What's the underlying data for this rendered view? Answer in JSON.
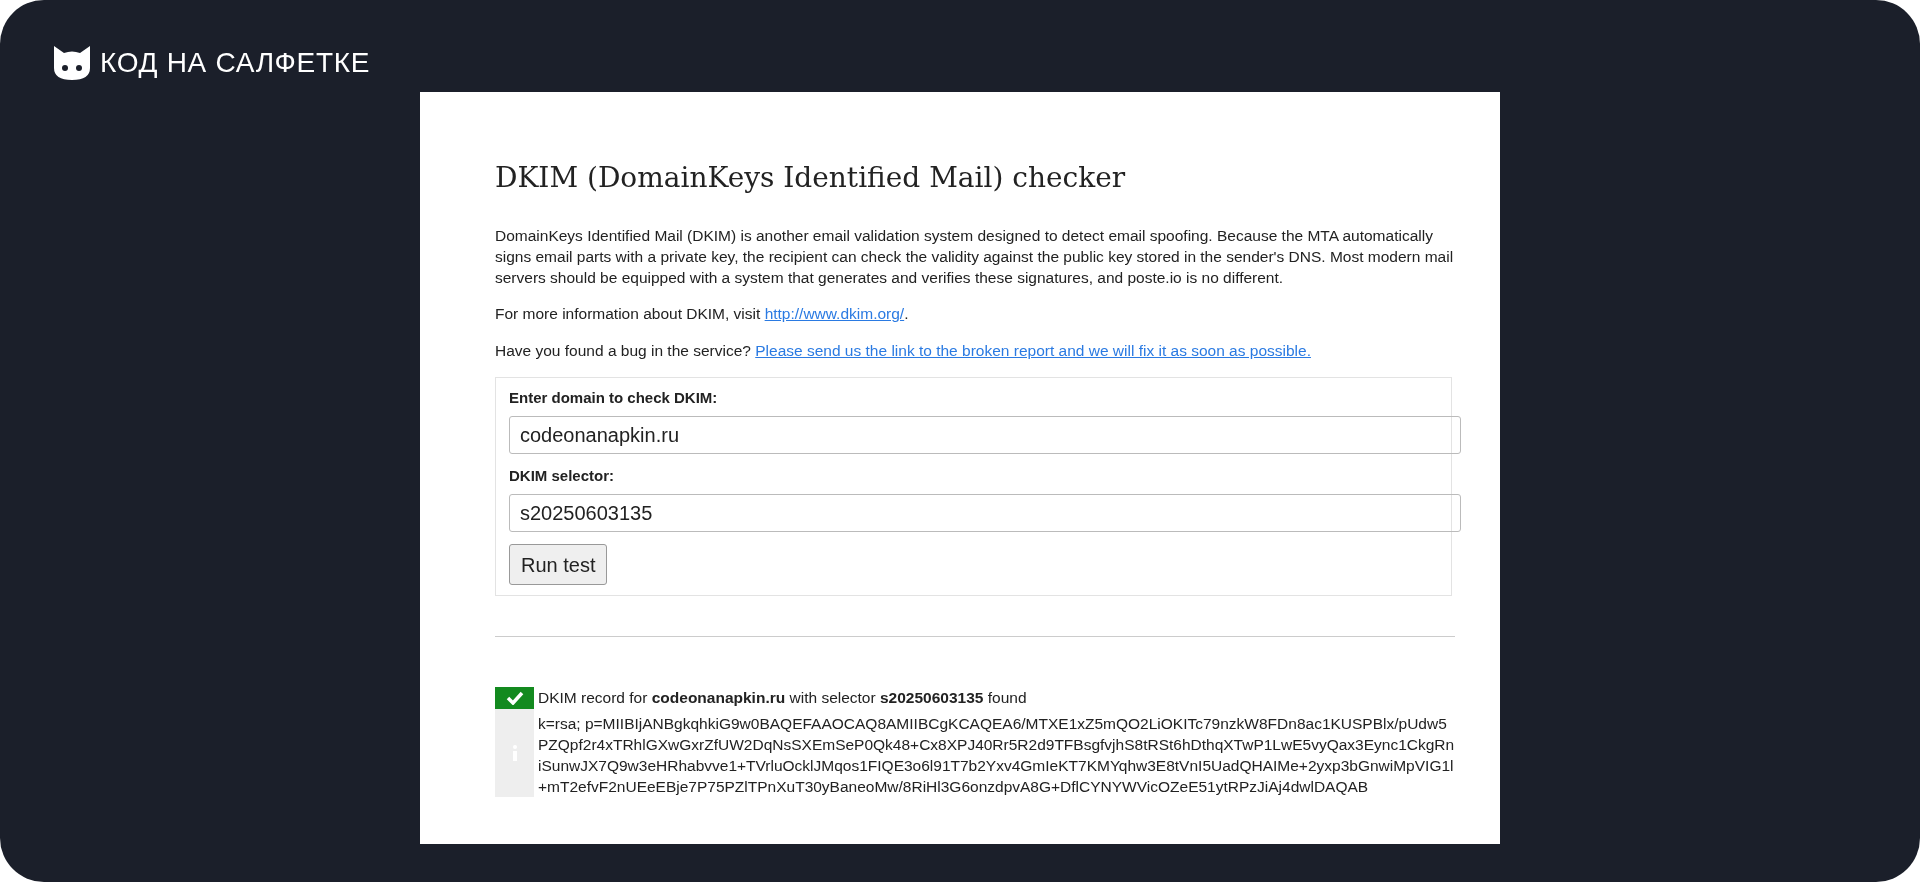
{
  "brand": {
    "name": "КОД НА САЛФЕТКЕ"
  },
  "page": {
    "title": "DKIM (DomainKeys Identified Mail) checker",
    "intro": "DomainKeys Identified Mail (DKIM) is another email validation system designed to detect email spoofing. Because the MTA automatically signs email parts with a private key, the recipient can check the validity against the public key stored in the sender's DNS. Most modern mail servers should be equipped with a system that generates and verifies these signatures, and poste.io is no different.",
    "info": {
      "text": "For more information about DKIM, visit ",
      "link": "http://www.dkim.org/",
      "after": "."
    },
    "bug": {
      "text": "Have you found a bug in the service? ",
      "link": "Please send us the link to the broken report and we will fix it as soon as possible."
    }
  },
  "form": {
    "fields": [
      {
        "label": "Enter domain to check DKIM:",
        "value": "codeonanapkin.ru"
      },
      {
        "label": "DKIM selector:",
        "value": "s20250603135"
      }
    ],
    "button": "Run test"
  },
  "result": {
    "found": true,
    "summary": "DKIM record for **codeonanapkin.ru** with selector **s20250603135** found",
    "record": "k=rsa; p=MIIBIjANBgkqhkiG9w0BAQEFAAOCAQ8AMIIBCgKCAQEA6/MTXE1xZ5mQO2LiOKITc79nzkW8FDn8ac1KUSPBlx/pUdw5PZQpf2r4xTRhlGXwGxrZfUW2DqNsSXEmSeP0Qk48+Cx8XPJ40Rr5R2d9TFBsgfvjhS8tRSt6hDthqXTwP1LwE5vyQax3Eync1CkgRniSunwJX7Q9w3eHRhabvve1+TVrluOcklJMqos1FIQE3o6l91T7b2Yxv4GmIeKT7KMYqhw3E8tVnI5UadQHAIMe+2yxp3bGnwiMpVIG1l+mT2efvF2nUEeEBje7P75PZlTPnXuT30yBaneoMw/8RiHl3G6onzdpvA8G+DflCYNYWVicOZeE51ytRPzJiAj4dwlDAQAB"
  }
}
